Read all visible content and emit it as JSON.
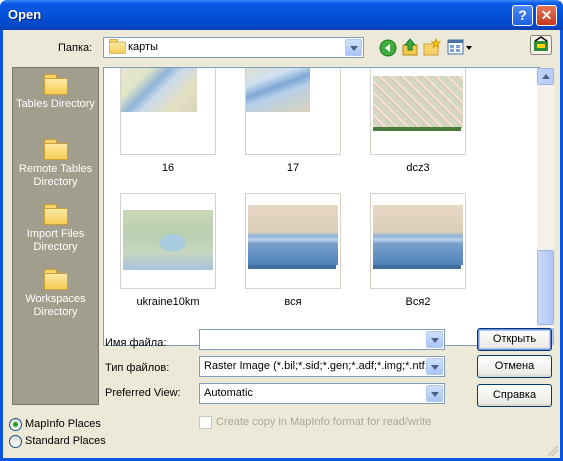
{
  "window": {
    "title": "Open",
    "help_glyph": "?",
    "close_glyph": "✕"
  },
  "lookin": {
    "label": "Папка:",
    "value": "карты"
  },
  "places": [
    {
      "label": "Tables Directory"
    },
    {
      "label": "Remote Tables Directory"
    },
    {
      "label": "Import Files Directory"
    },
    {
      "label": "Workspaces Directory"
    }
  ],
  "files": [
    {
      "name": "16"
    },
    {
      "name": "17"
    },
    {
      "name": "dcz3"
    },
    {
      "name": "ukraine10km"
    },
    {
      "name": "вся"
    },
    {
      "name": "Вся2"
    }
  ],
  "filename": {
    "label": "Имя файла:",
    "value": ""
  },
  "filetype": {
    "label": "Тип файлов:",
    "value": "Raster Image (*.bil;*.sid;*.gen;*.adf;*.img;*.ntf;*.c"
  },
  "preferred": {
    "label": "Preferred View:",
    "value": "Automatic"
  },
  "buttons": {
    "open": "Открыть",
    "cancel": "Отмена",
    "help": "Справка"
  },
  "copy_checkbox": {
    "label": "Create copy in MapInfo format for read/write",
    "checked": false,
    "enabled": false
  },
  "place_options": {
    "mapinfo": "MapInfo Places",
    "standard": "Standard Places",
    "selected": "mapinfo"
  },
  "colors": {
    "title_bar": "#0a54e0",
    "dialog_bg": "#ece9d8",
    "places_bg": "#a19e8d"
  }
}
